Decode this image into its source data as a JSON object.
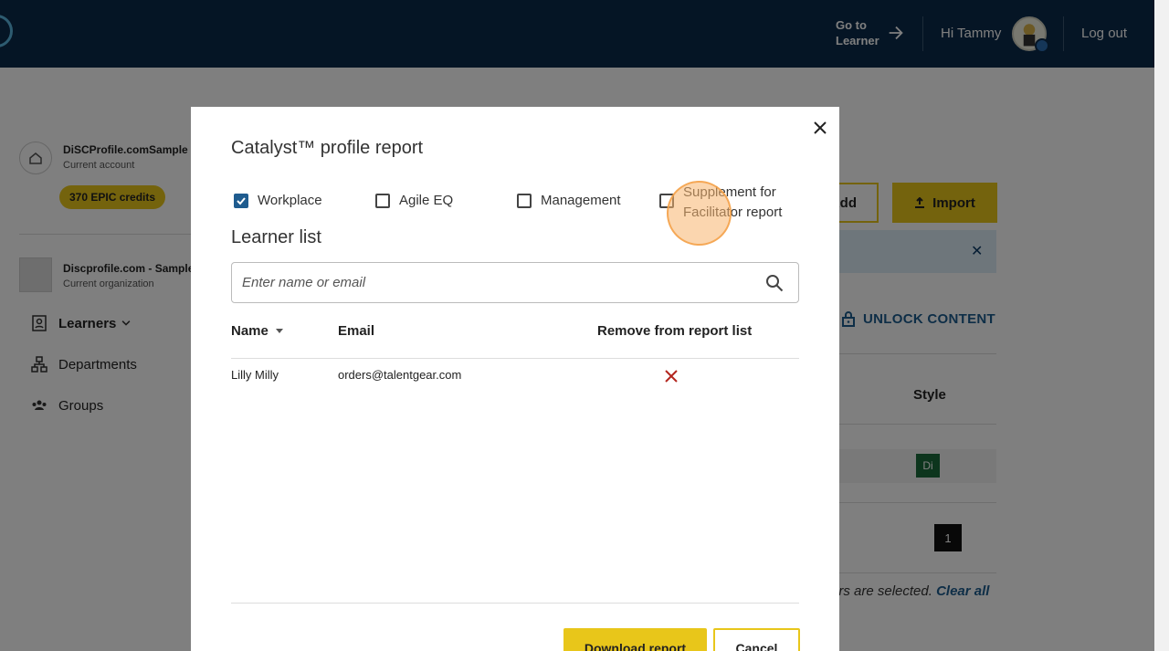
{
  "header": {
    "go_to": "Go to",
    "learner": "Learner",
    "greeting": "Hi Tammy",
    "logout": "Log out"
  },
  "sidebar": {
    "account_name": "DiSCProfile.comSample",
    "account_sub": "Current account",
    "credits": "370 EPIC credits",
    "org_name": "Discprofile.com - Sample",
    "org_sub": "Current organization",
    "nav": [
      {
        "label": "Learners"
      },
      {
        "label": "Departments"
      },
      {
        "label": "Groups"
      }
    ]
  },
  "main": {
    "add_label": "Add",
    "import_label": "Import",
    "info_text": ".",
    "unlock_label": "UNLOCK CONTENT",
    "style_header": "Style",
    "style_badge": "Di",
    "count_badge": "1",
    "selected_text": "ers are selected.",
    "clear_all": "Clear all"
  },
  "modal": {
    "title": "Catalyst™ profile report",
    "options": [
      {
        "label": "Workplace",
        "checked": true
      },
      {
        "label": "Agile EQ",
        "checked": false
      },
      {
        "label": "Management",
        "checked": false
      },
      {
        "label": "Supplement for Facilitator report",
        "checked": false
      }
    ],
    "learner_list_heading": "Learner list",
    "search_placeholder": "Enter name or email",
    "columns": {
      "name": "Name",
      "email": "Email",
      "remove": "Remove from report list"
    },
    "rows": [
      {
        "name": "Lilly Milly",
        "email": "orders@talentgear.com"
      }
    ],
    "download_label": "Download report",
    "cancel_label": "Cancel"
  }
}
